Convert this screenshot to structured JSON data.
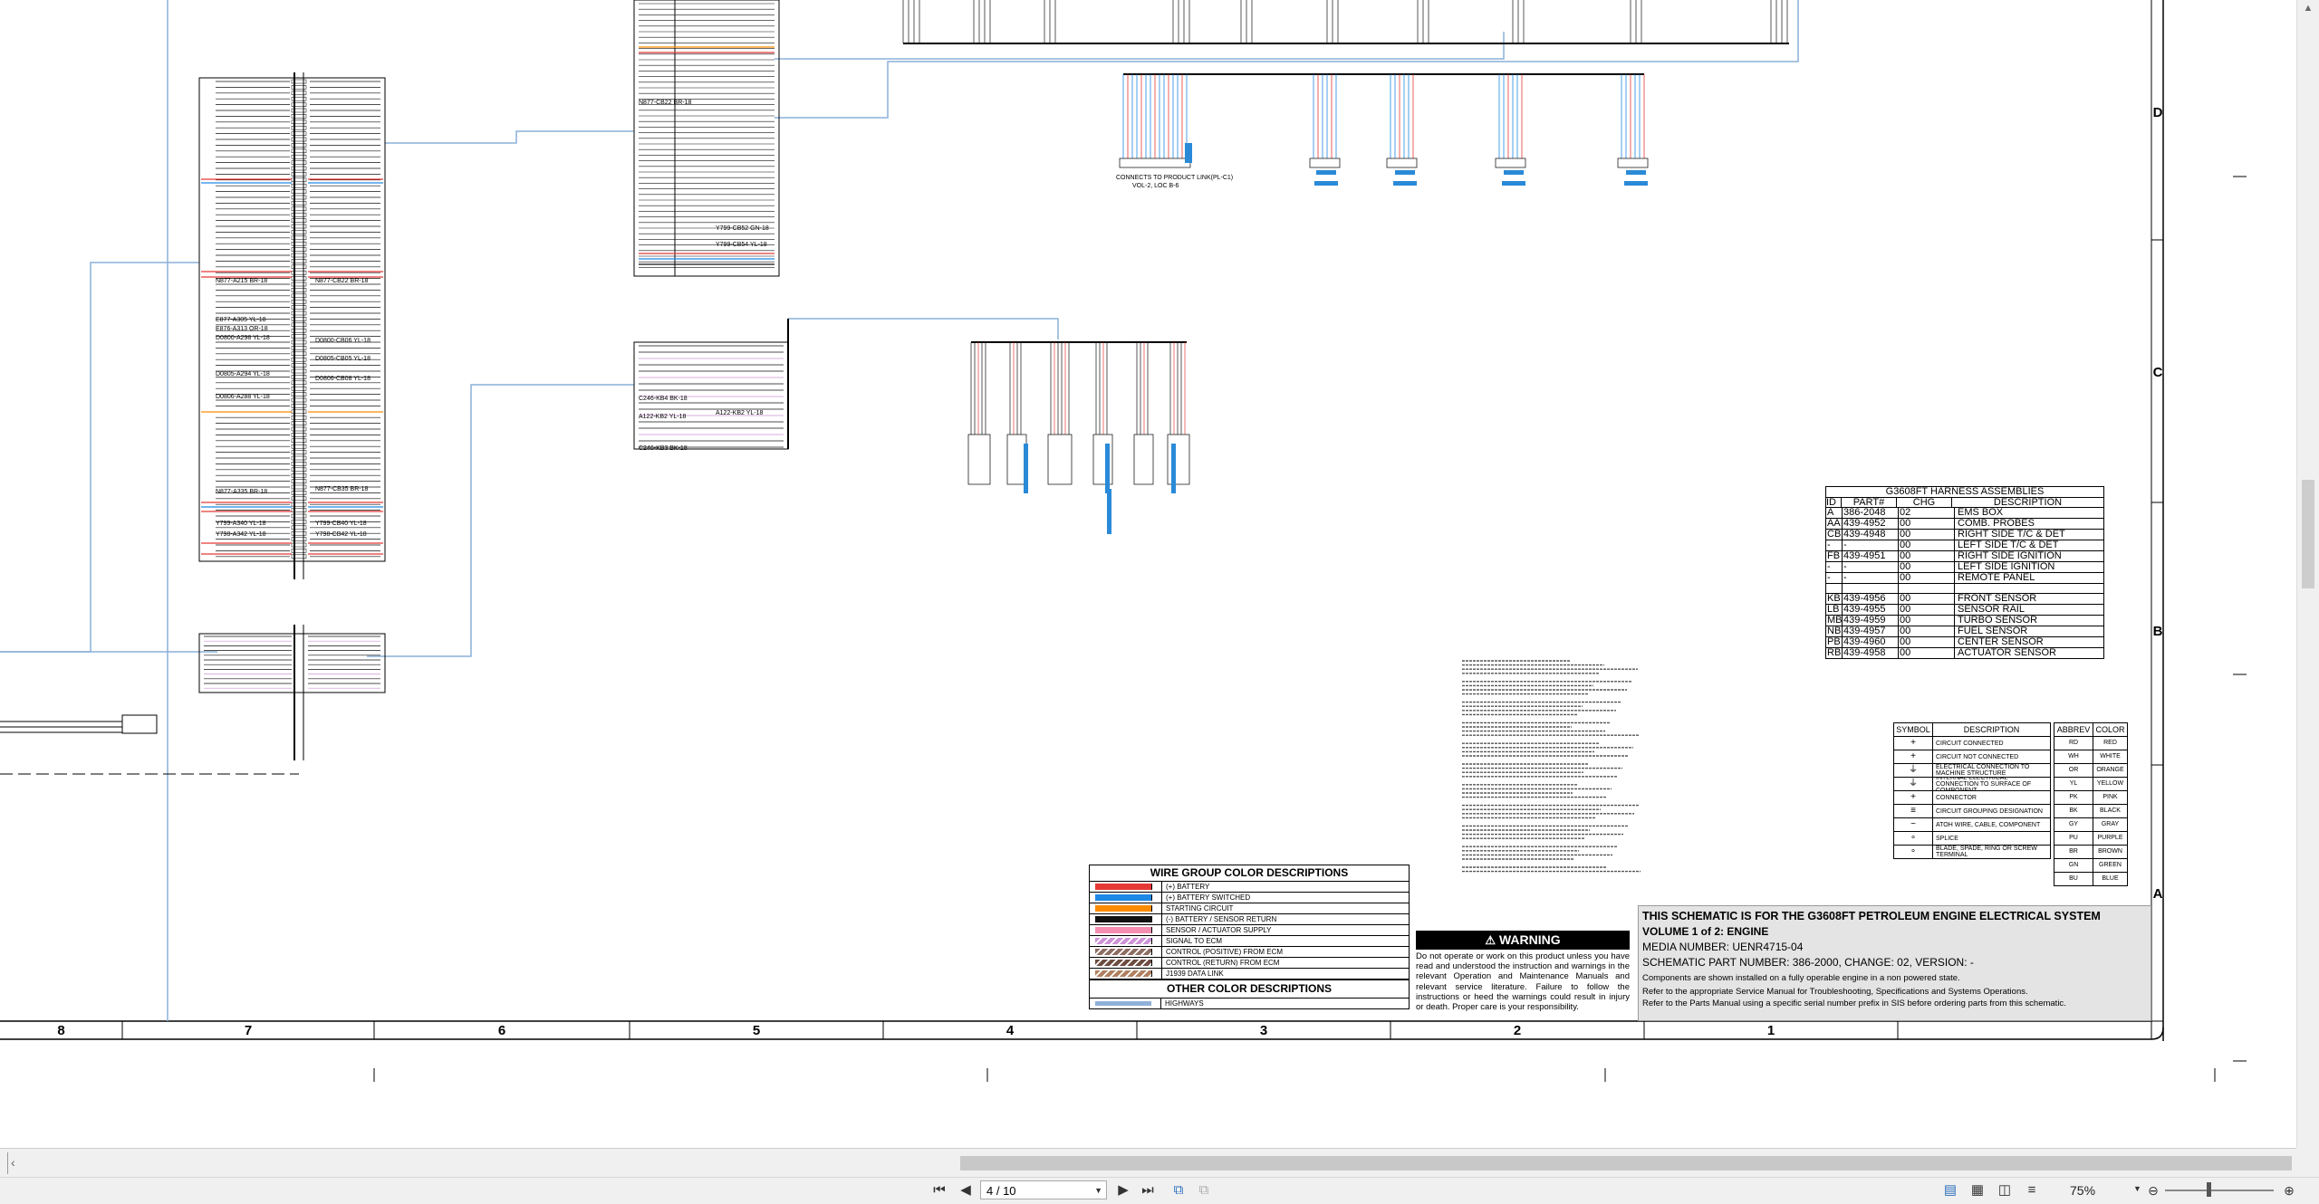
{
  "harness_table": {
    "title": "G3608FT HARNESS ASSEMBLIES",
    "headers": [
      "ID",
      "PART#",
      "CHG",
      "DESCRIPTION"
    ],
    "rows": [
      [
        "A",
        "386-2048",
        "02",
        "EMS BOX"
      ],
      [
        "AA",
        "439-4952",
        "00",
        "COMB. PROBES"
      ],
      [
        "CB",
        "439-4948",
        "00",
        "RIGHT SIDE T/C & DET"
      ],
      [
        "-",
        "-",
        "00",
        "LEFT SIDE T/C & DET"
      ],
      [
        "FB",
        "439-4951",
        "00",
        "RIGHT SIDE IGNITION"
      ],
      [
        "-",
        "-",
        "00",
        "LEFT SIDE IGNITION"
      ],
      [
        "-",
        "-",
        "00",
        "REMOTE PANEL"
      ],
      [
        "",
        "",
        "",
        ""
      ],
      [
        "KB",
        "439-4956",
        "00",
        "FRONT SENSOR"
      ],
      [
        "LB",
        "439-4955",
        "00",
        "SENSOR RAIL"
      ],
      [
        "MB",
        "439-4959",
        "00",
        "TURBO SENSOR"
      ],
      [
        "NB",
        "439-4957",
        "00",
        "FUEL SENSOR"
      ],
      [
        "PB",
        "439-4960",
        "00",
        "CENTER SENSOR"
      ],
      [
        "RB",
        "439-4958",
        "00",
        "ACTUATOR SENSOR"
      ]
    ]
  },
  "symbol_table": {
    "headers": [
      "SYMBOL",
      "DESCRIPTION"
    ],
    "rows": [
      "CIRCUIT CONNECTED",
      "CIRCUIT NOT CONNECTED",
      "ELECTRICAL CONNECTION TO MACHINE STRUCTURE",
      "INTERNAL ELECTRICAL CONNECTION TO SURFACE OF COMPONENT",
      "CONNECTOR",
      "CIRCUIT GROUPING DESIGNATION",
      "ATOH WIRE, CABLE, COMPONENT",
      "SPLICE",
      "BLADE, SPADE, RING OR SCREW TERMINAL"
    ]
  },
  "color_table": {
    "headers": [
      "ABBREV",
      "COLOR"
    ],
    "rows": [
      [
        "RD",
        "RED"
      ],
      [
        "WH",
        "WHITE"
      ],
      [
        "OR",
        "ORANGE"
      ],
      [
        "YL",
        "YELLOW"
      ],
      [
        "PK",
        "PINK"
      ],
      [
        "BK",
        "BLACK"
      ],
      [
        "GY",
        "GRAY"
      ],
      [
        "PU",
        "PURPLE"
      ],
      [
        "BR",
        "BROWN"
      ],
      [
        "GN",
        "GREEN"
      ],
      [
        "BU",
        "BLUE"
      ]
    ]
  },
  "wire_group": {
    "title": "WIRE GROUP COLOR DESCRIPTIONS",
    "rows": [
      {
        "label": "(+) BATTERY",
        "color": "#e53935"
      },
      {
        "label": "(+) BATTERY SWITCHED",
        "color": "#1e88e5"
      },
      {
        "label": "STARTING CIRCUIT",
        "color": "#fb8c00"
      },
      {
        "label": "(-) BATTERY / SENSOR RETURN",
        "color": "#111111"
      },
      {
        "label": "SENSOR / ACTUATOR SUPPLY",
        "color": "#f48fb1"
      },
      {
        "label": "SIGNAL TO ECM",
        "color": "#ce93d8"
      },
      {
        "label": "CONTROL (POSITIVE) FROM ECM",
        "color": "#8d6e63"
      },
      {
        "label": "CONTROL (RETURN) FROM ECM",
        "color": "#6d4c41"
      },
      {
        "label": "J1939 DATA LINK",
        "color": "#b08060"
      }
    ],
    "other_title": "OTHER COLOR DESCRIPTIONS",
    "other_rows": [
      {
        "label": "HIGHWAYS",
        "color": "#90b0d8"
      }
    ]
  },
  "warning": {
    "title": "WARNING",
    "text": "Do not operate or work on this product unless you have read and understood the instruction and warnings in the relevant Operation and Maintenance Manuals and relevant service literature. Failure to follow the instructions or heed the warnings could result in injury or death. Proper care is your responsibility."
  },
  "title_block": {
    "line1": "THIS SCHEMATIC IS FOR THE G3608FT PETROLEUM ENGINE ELECTRICAL SYSTEM",
    "line2": "VOLUME 1 of 2: ENGINE",
    "media": "MEDIA NUMBER: UENR4715-04",
    "part": "SCHEMATIC PART NUMBER: 386-2000, CHANGE: 02, VERSION: -",
    "note1": "Components are shown installed on a fully operable engine in a non powered state.",
    "note2": "Refer to the appropriate Service Manual for Troubleshooting, Specifications and Systems Operations.",
    "note3": "Refer to the Parts Manual using a specific serial number prefix in SIS before ordering parts from this schematic."
  },
  "grid": {
    "columns": [
      "8",
      "7",
      "6",
      "5",
      "4",
      "3",
      "2",
      "1"
    ],
    "rows": [
      "D",
      "C",
      "B",
      "A"
    ]
  },
  "schematic_labels": {
    "connects_to": "CONNECTS TO PRODUCT LINK(PL-C1)",
    "connects_loc": "VOL-2, LOC B-6",
    "wires_col1": [
      "N877-A215 BR-18",
      "E877-A305 YL-18",
      "E876-A313 OR-18",
      "D0800-A298 YL-18",
      "D0805-A294 YL-18",
      "D0806-A288 YL-18",
      "N877-A335 BR-18",
      "Y799-A340 YL-18",
      "Y798-A342 YL-18"
    ],
    "wires_col2": [
      "N877-CB22 BR-18",
      "D0800-CB06 YL-18",
      "D0805-CB05 YL-18",
      "D0806-CB08 YL-18",
      "N877-CB35 BR-18",
      "Y799-CB40 YL-18",
      "Y798-CB42 YL-18"
    ],
    "wires_box2": [
      "N877-CB22 BR-18",
      "C246-KB4 BK-18",
      "A122-KB2 YL-18",
      "C246-KB3 BK-18"
    ],
    "wires_box2_right": [
      "Y799-CB52 GN-18",
      "Y799-CB54 YL-18",
      "A122-KB2 YL-18"
    ]
  },
  "status_bar": {
    "page_value": "4 / 10",
    "zoom_value": "75%"
  }
}
